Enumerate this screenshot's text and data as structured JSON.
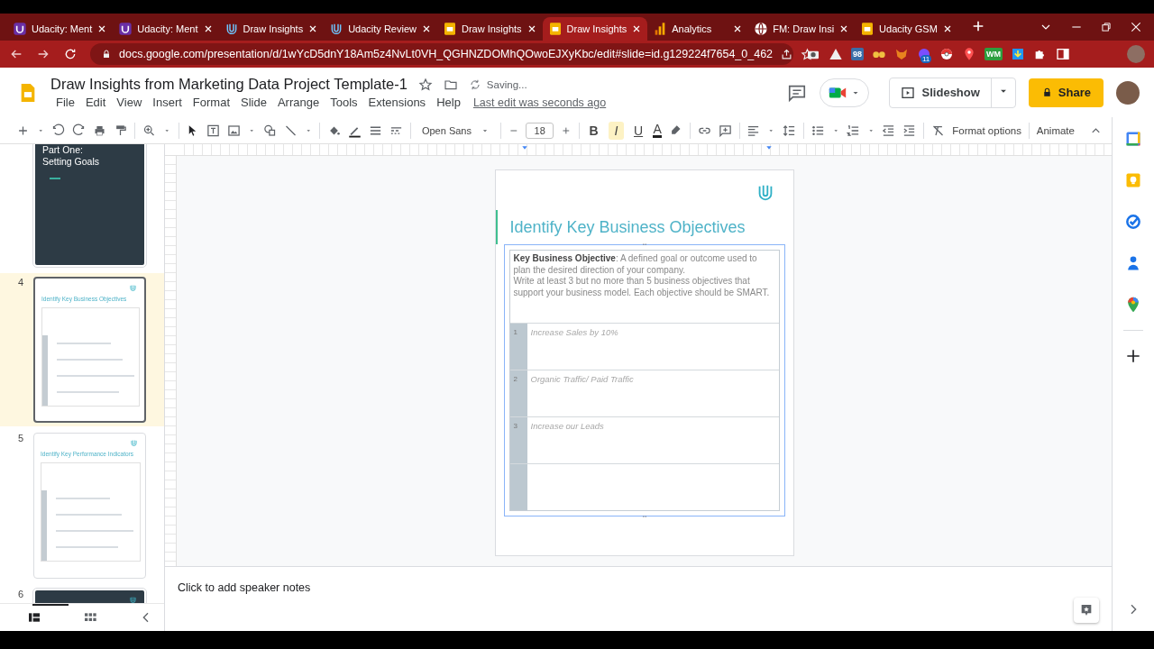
{
  "browser": {
    "tabs": [
      {
        "title": "Udacity: Ment",
        "kind": "udacity-purple",
        "selected": false
      },
      {
        "title": "Udacity: Ment",
        "kind": "udacity-purple",
        "selected": false
      },
      {
        "title": "Draw Insights",
        "kind": "udacity",
        "selected": false
      },
      {
        "title": "Udacity Review",
        "kind": "udacity",
        "selected": false
      },
      {
        "title": "Draw Insights",
        "kind": "slides",
        "selected": false
      },
      {
        "title": "Draw Insights",
        "kind": "slides",
        "selected": true
      },
      {
        "title": "Analytics",
        "kind": "analytics",
        "selected": false
      },
      {
        "title": "FM: Draw Insi",
        "kind": "web",
        "selected": false
      },
      {
        "title": "Udacity GSM",
        "kind": "slides",
        "selected": false
      }
    ],
    "url": "docs.google.com/presentation/d/1wYcD5dnY18Am5z4NvLt0VH_QGHNZDOMhQOwoEJXyKbc/edit#slide=id.g129224f7654_0_462",
    "extensions": [
      {
        "kind": "camera"
      },
      {
        "kind": "triangle"
      },
      {
        "kind": "label-box",
        "label": "98"
      },
      {
        "kind": "glasses"
      },
      {
        "kind": "fox"
      },
      {
        "kind": "circle",
        "badge": "11"
      },
      {
        "kind": "ball"
      },
      {
        "kind": "pin"
      },
      {
        "kind": "label-green",
        "label": "WM"
      },
      {
        "kind": "download"
      },
      {
        "kind": "puzzle"
      },
      {
        "kind": "sidebar"
      }
    ]
  },
  "document": {
    "title": "Draw Insights from Marketing Data Project Template-1",
    "save_status": "Saving...",
    "menu": [
      "File",
      "Edit",
      "View",
      "Insert",
      "Format",
      "Slide",
      "Arrange",
      "Tools",
      "Extensions",
      "Help"
    ],
    "last_edit": "Last edit was seconds ago",
    "slideshow": "Slideshow",
    "share": "Share"
  },
  "toolbar": {
    "font": "Open Sans",
    "font_size": "18",
    "text_styles": [
      {
        "label": "B",
        "kind": "bold",
        "selected": false
      },
      {
        "label": "I",
        "kind": "italic",
        "selected": true
      },
      {
        "label": "U",
        "kind": "underline",
        "selected": false
      }
    ],
    "text_color": "A",
    "format_options": "Format options",
    "animate": "Animate"
  },
  "filmstrip": {
    "slides": [
      {
        "kind": "section",
        "title": "Part One:\nSetting Goals",
        "selected": false
      },
      {
        "number": "4",
        "kind": "content",
        "title": "Identify Key Business Objectives",
        "selected": true
      },
      {
        "number": "5",
        "kind": "content",
        "title": "Identify Key Performance Indicators",
        "selected": false
      },
      {
        "number": "6",
        "kind": "section",
        "selected": false
      }
    ]
  },
  "slide": {
    "title": "Identify Key Business Objectives",
    "description": "**Key Business Objective**: A defined goal or outcome used to plan the desired direction of your company.",
    "instructions": "Write at least 3 but no more than 5 business objectives that support your business model. Each objective should be SMART.",
    "rows": [
      {
        "number": "1",
        "text": "Increase Sales  by 10%"
      },
      {
        "number": "2",
        "text": "Organic Traffic/ Paid Traffic"
      },
      {
        "number": "3",
        "text": "Increase our Leads"
      }
    ]
  },
  "notes": {
    "placeholder": "Click to add speaker notes"
  }
}
